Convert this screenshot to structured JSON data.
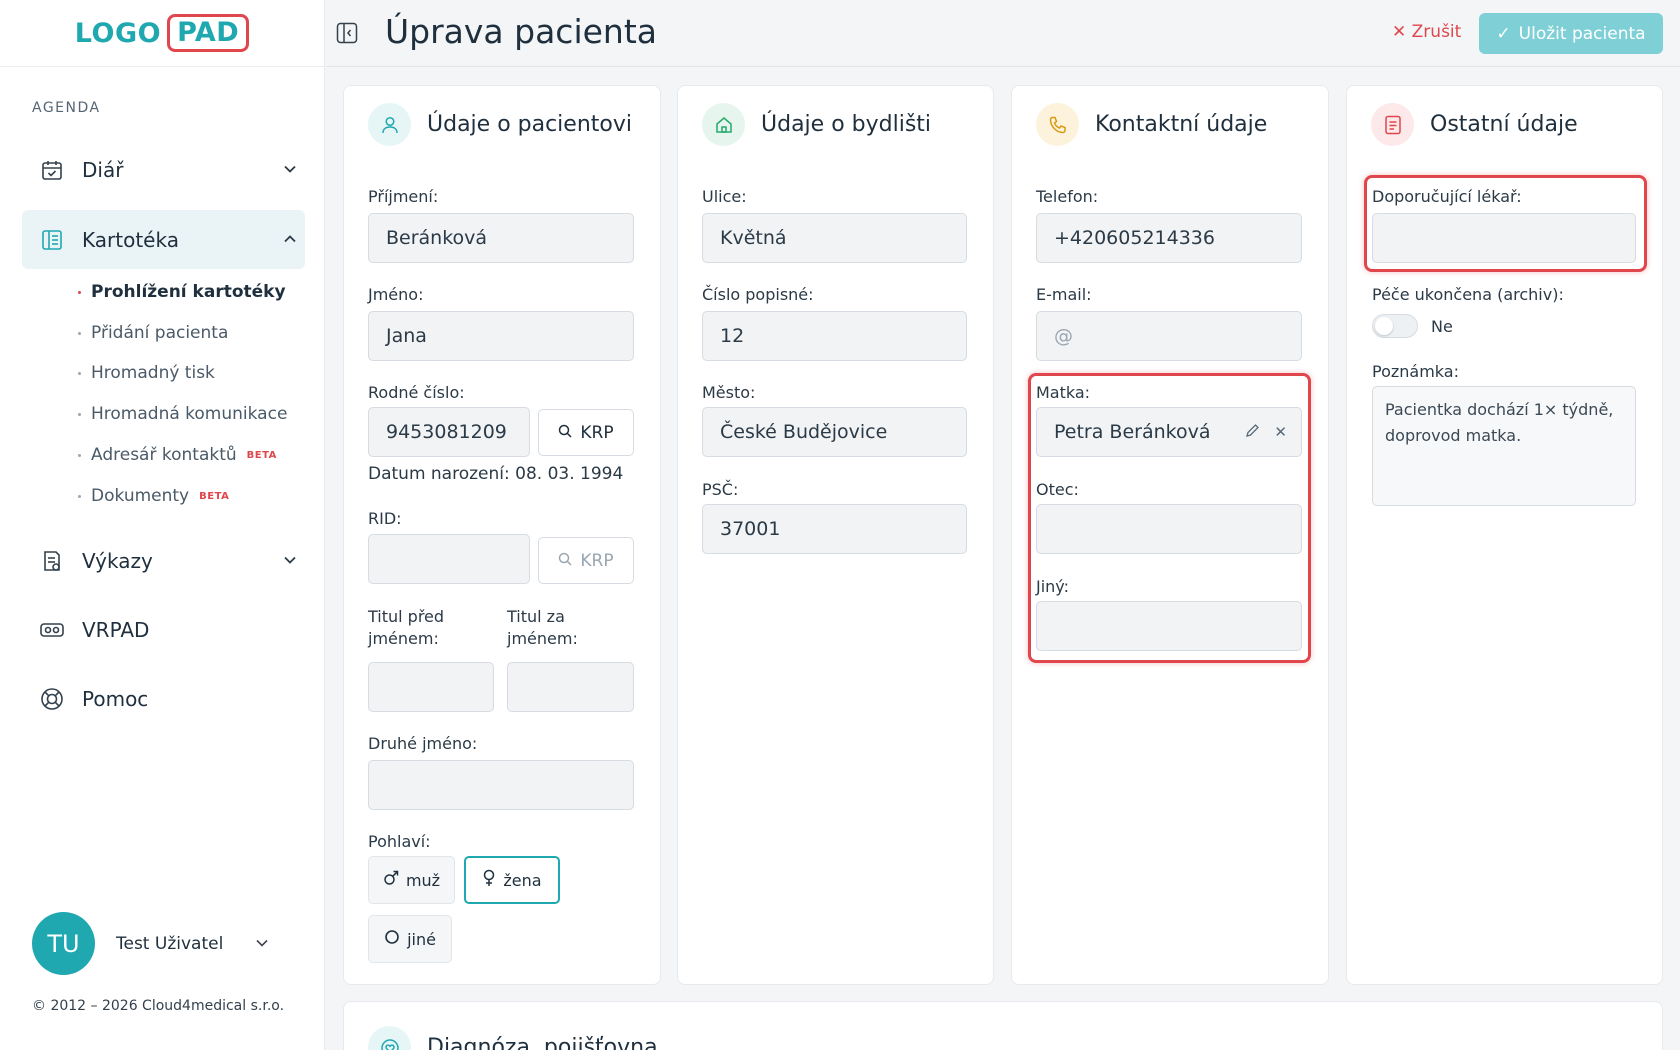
{
  "logo": {
    "left": "LOGO",
    "right": "PAD"
  },
  "sidebar": {
    "section_label": "AGENDA",
    "items": [
      {
        "label": "Diář"
      },
      {
        "label": "Kartotéka"
      },
      {
        "label": "Výkazy"
      },
      {
        "label": "VRPAD"
      },
      {
        "label": "Pomoc"
      }
    ],
    "subitems": [
      {
        "label": "Prohlížení kartotéky"
      },
      {
        "label": "Přidání pacienta"
      },
      {
        "label": "Hromadný tisk"
      },
      {
        "label": "Hromadná komunikace"
      },
      {
        "label": "Adresář kontaktů",
        "badge": "BETA"
      },
      {
        "label": "Dokumenty",
        "badge": "BETA"
      }
    ],
    "user": {
      "initials": "TU",
      "name": "Test Uživatel"
    },
    "copyright": "© 2012 – 2026 Cloud4medical s.r.o."
  },
  "header": {
    "title": "Úprava pacienta",
    "cancel_label": "Zrušit",
    "save_label": "Uložit pacienta"
  },
  "patient": {
    "title": "Údaje o pacientovi",
    "surname_label": "Příjmení:",
    "surname": "Beránková",
    "name_label": "Jméno:",
    "name": "Jana",
    "birth_number_label": "Rodné číslo:",
    "birth_number": "9453081209",
    "krp_label": "KRP",
    "birth_date": "Datum narození: 08. 03. 1994",
    "rid_label": "RID:",
    "title_before_label_1": "Titul před",
    "title_before_label_2": "jménem:",
    "title_after_label_1": "Titul za",
    "title_after_label_2": "jménem:",
    "second_name_label": "Druhé jméno:",
    "gender_label": "Pohlaví:",
    "gender_male": "muž",
    "gender_female": "žena",
    "gender_other": "jiné"
  },
  "address": {
    "title": "Údaje o bydlišti",
    "street_label": "Ulice:",
    "street": "Květná",
    "number_label": "Číslo popisné:",
    "number": "12",
    "city_label": "Město:",
    "city": "České Budějovice",
    "zip_label": "PSČ:",
    "zip": "37001"
  },
  "contact": {
    "title": "Kontaktní údaje",
    "phone_label": "Telefon:",
    "phone": "+420605214336",
    "email_label": "E-mail:",
    "email_placeholder": "@",
    "mother_label": "Matka:",
    "mother": "Petra Beránková",
    "father_label": "Otec:",
    "other_label": "Jiný:"
  },
  "other": {
    "title": "Ostatní údaje",
    "doctor_label": "Doporučující lékař:",
    "archive_label": "Péče ukončena (archiv):",
    "archive_value": "Ne",
    "note_label": "Poznámka:",
    "note": "Pacientka dochází 1× týdně, doprovod matka."
  },
  "bottom": {
    "title": "Diagnóza, pojišťovna"
  },
  "colors": {
    "accent": "#1fa8b0",
    "highlight": "#e0474c"
  }
}
